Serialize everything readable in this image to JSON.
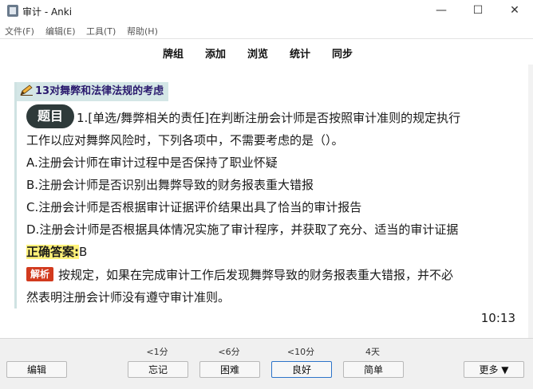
{
  "window": {
    "title": "审计 - Anki",
    "minimize": "—",
    "maximize": "☐",
    "close": "✕"
  },
  "menu": [
    "文件(F)",
    "编辑(E)",
    "工具(T)",
    "帮助(H)"
  ],
  "toolbar": [
    "牌组",
    "添加",
    "浏览",
    "统计",
    "同步"
  ],
  "card": {
    "category": "13对舞弊和法律法规的考虑",
    "badge": "题目",
    "question_line1": "1.[单选/舞弊相关的责任]在判断注册会计师是否按照审计准则的规定执行",
    "question_line2": "工作以应对舞弊风险时，下列各项中，不需要考虑的是（）。",
    "options": [
      "A.注册会计师在审计过程中是否保持了职业怀疑",
      "B.注册会计师是否识别出舞弊导致的财务报表重大错报",
      "C.注册会计师是否根据审计证据评价结果出具了恰当的审计报告",
      "D.注册会计师是否根据具体情况实施了审计程序，并获取了充分、适当的审计证据"
    ],
    "answer_label": "正确答案:",
    "answer_value": "B",
    "analysis_tag": "解析",
    "analysis_line1": "按规定，如果在完成审计工作后发现舞弊导致的财务报表重大错报，并不必",
    "analysis_line2": "然表明注册会计师没有遵守审计准则。",
    "timer": "10:13"
  },
  "answer_bar": {
    "edit": "编辑",
    "intervals": [
      "<1分",
      "<6分",
      "<10分",
      "4天"
    ],
    "ease_buttons": [
      "忘记",
      "困难",
      "良好",
      "简单"
    ],
    "more": "更多 ▼"
  }
}
